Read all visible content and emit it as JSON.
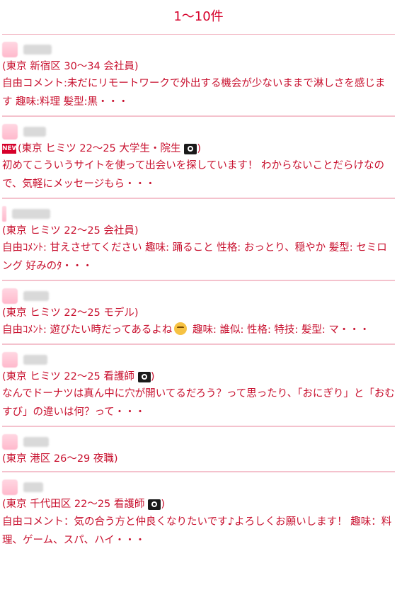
{
  "header": {
    "count_label": "1〜10件"
  },
  "entries": [
    {
      "info": "(東京 新宿区 30〜34 会社員)",
      "comment": "自由コメント:未だにリモートワークで外出する機会が少ないままで淋しさを感じます 趣味:料理 髪型:黒・・・"
    },
    {
      "badge": "NEW",
      "info": "(東京 ヒミツ 22〜25 大学生・院生",
      "info_suffix": ")",
      "comment": "初めてこういうサイトを使って出会いを探しています！ わからないことだらけなので、気軽にメッセージもら・・・"
    },
    {
      "info": "(東京 ヒミツ 22〜25 会社員)",
      "comment": "自由ｺﾒﾝﾄ: 甘えさせてください 趣味: 踊ること 性格: おっとり、穏やか 髪型: セミロング 好みのﾀ・・・"
    },
    {
      "info": "(東京 ヒミツ 22〜25 モデル)",
      "comment_a": "自由ｺﾒﾝﾄ: 遊びたい時だってあるよね",
      "comment_b": " 趣味: 誰似: 性格: 特技: 髪型: マ・・・"
    },
    {
      "info": "(東京 ヒミツ 22〜25 看護師",
      "info_suffix": ")",
      "comment": "なんでドーナツは真ん中に穴が開いてるだろう？って思ったり、「おにぎり」と「おむすび」の違いは何？って・・・"
    },
    {
      "info": "(東京 港区 26〜29 夜職)"
    },
    {
      "info": "(東京 千代田区 22〜25 看護師",
      "info_suffix": ")",
      "comment_a": "自由コメント：気の合う方と仲良くなりたいです",
      "comment_b": "よろしくお願いします！ 趣味：料理、ゲーム、スパ、ハイ・・・"
    }
  ],
  "icons": {
    "camera": "camera-icon",
    "emoji": "relieved-face-icon",
    "music": "music-note-icon",
    "new": "new-badge-icon"
  },
  "colors": {
    "text": "#c8102e",
    "divider": "#f4c2cd"
  }
}
